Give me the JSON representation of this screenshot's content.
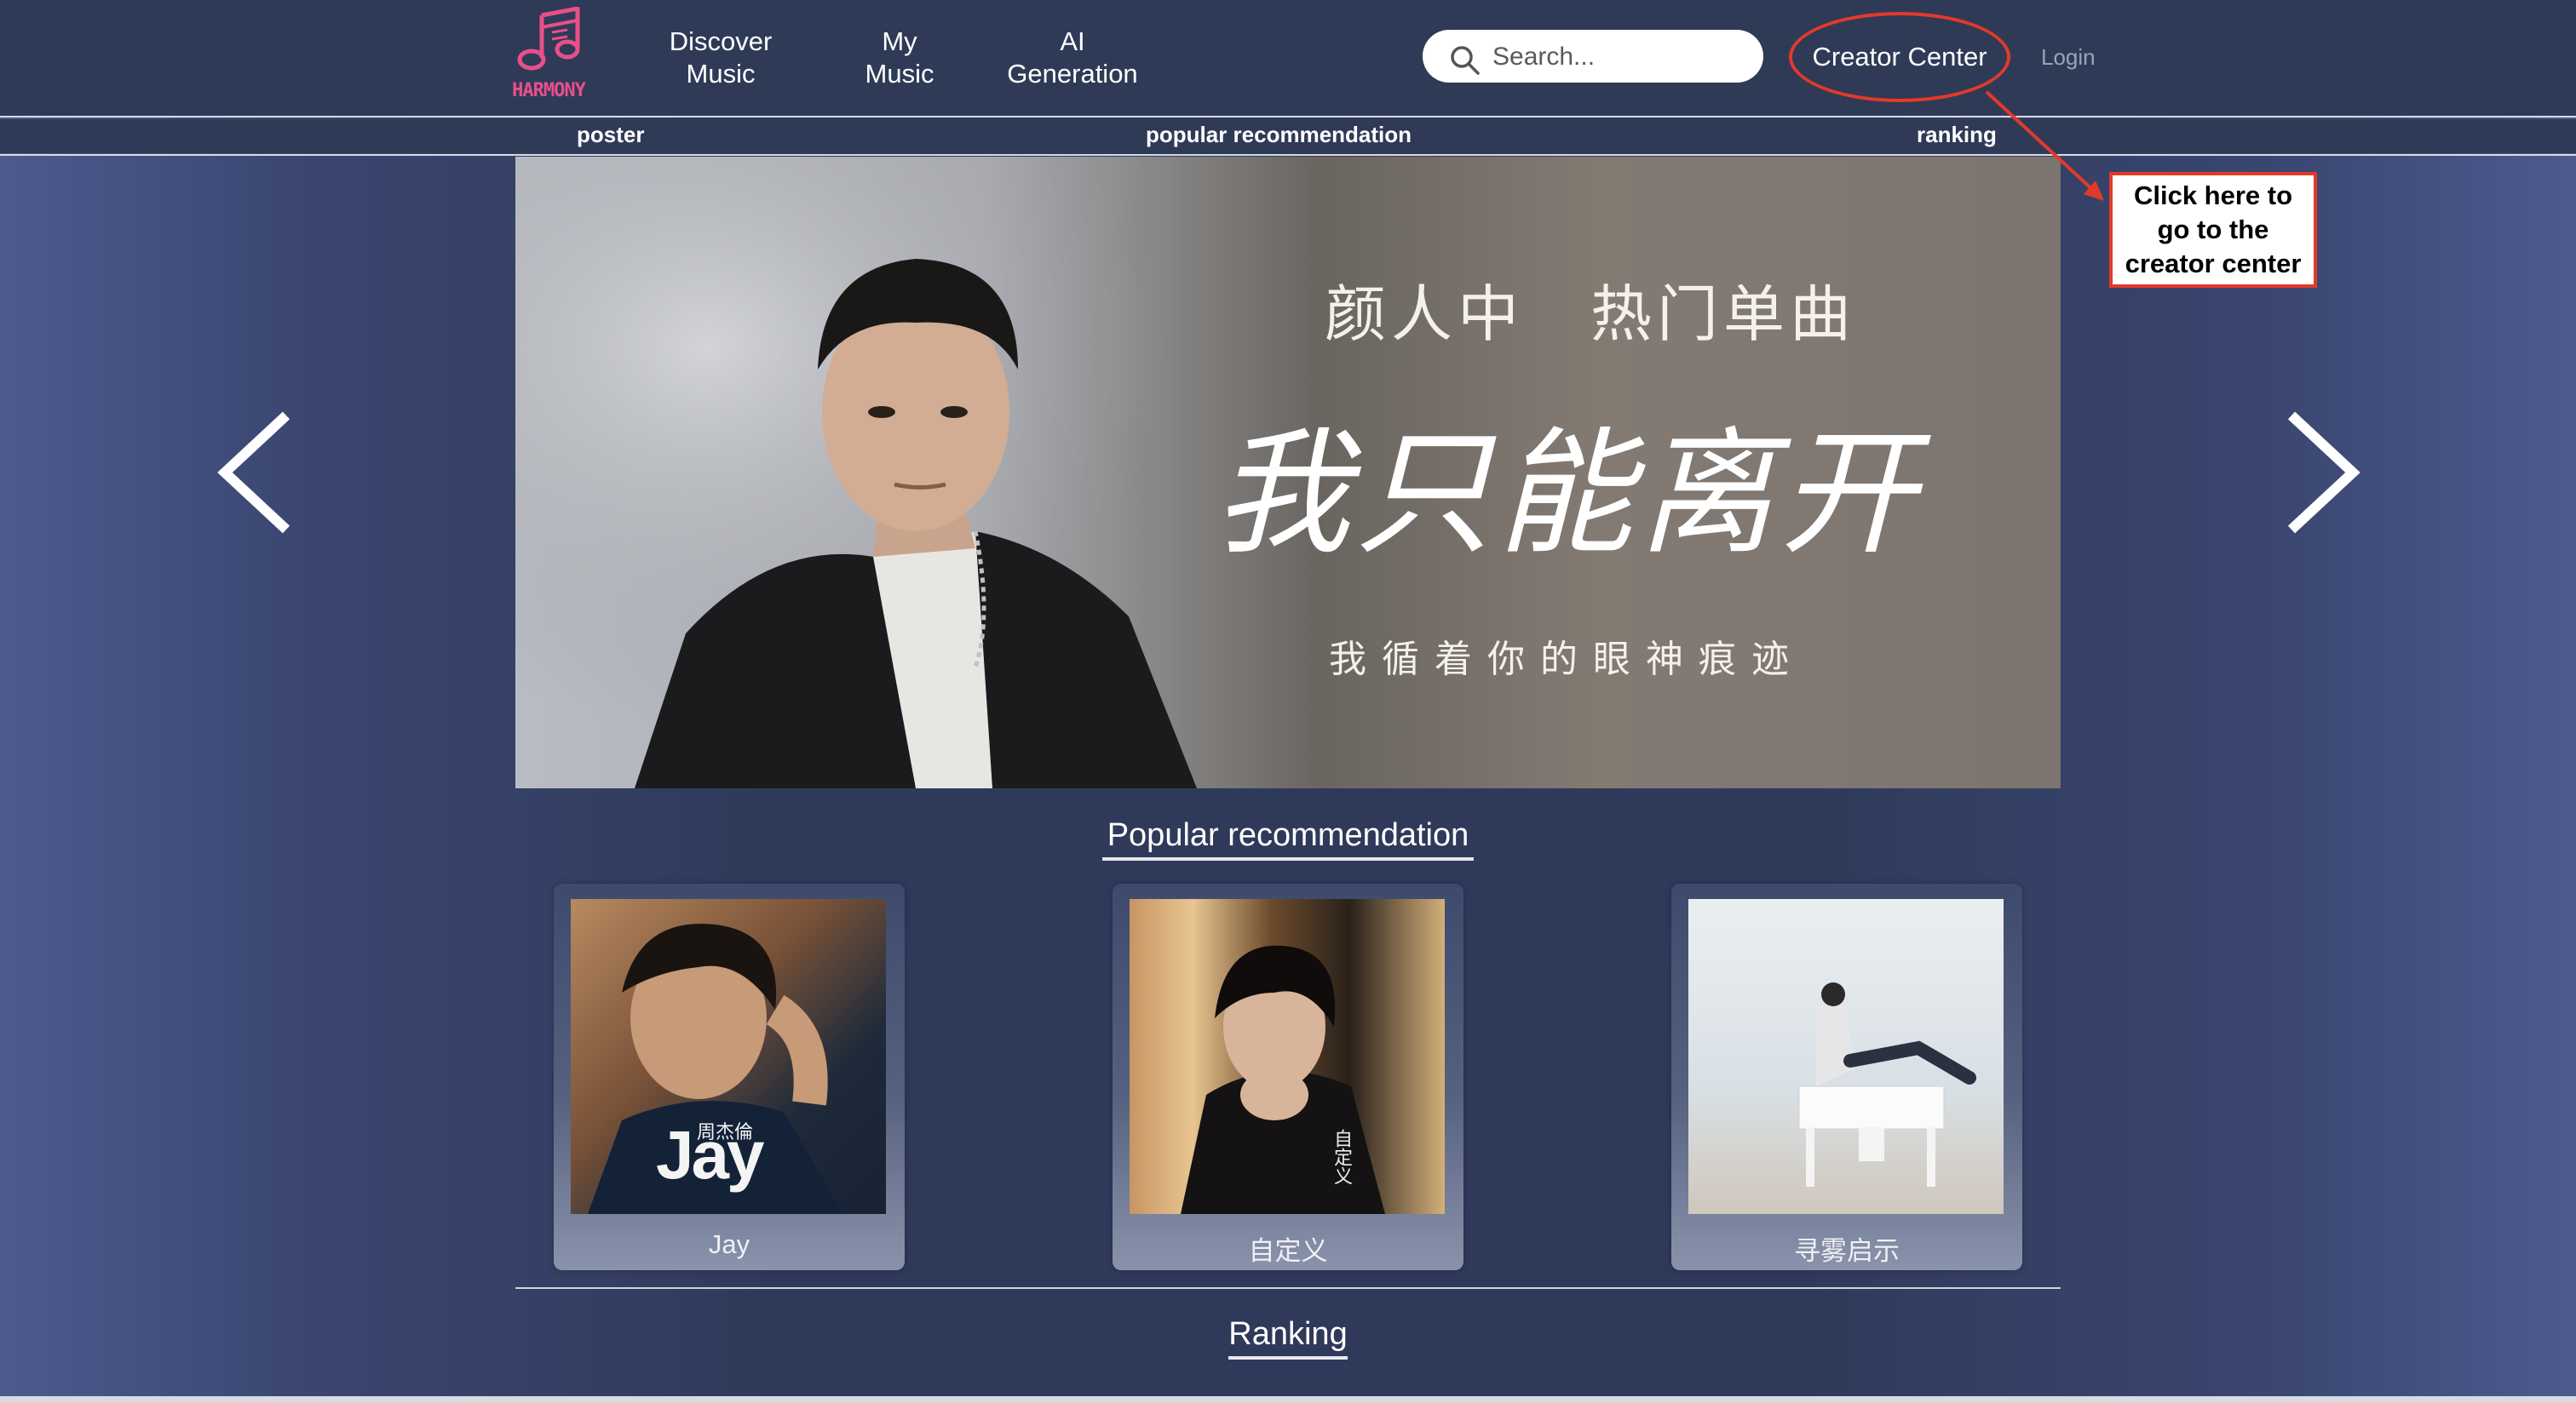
{
  "header": {
    "logo_text": "HARMONY",
    "nav": [
      {
        "line1": "Discover",
        "line2": "Music"
      },
      {
        "line1": "My",
        "line2": "Music"
      },
      {
        "line1": "AI",
        "line2": "Generation"
      }
    ],
    "search_placeholder": "Search...",
    "creator_center": "Creator Center",
    "login": "Login"
  },
  "subnav": {
    "poster": "poster",
    "popular": "popular recommendation",
    "ranking": "ranking"
  },
  "banner": {
    "title": "颜人中　热门单曲",
    "song": "我只能离开",
    "lyric": "我循着你的眼神痕迹"
  },
  "annotation": {
    "text_line1": "Click here to",
    "text_line2": "go to the",
    "text_line3": "creator center",
    "color": "#e23a2a"
  },
  "popular": {
    "title": "Popular recommendation",
    "items": [
      {
        "label": "Jay",
        "cover_text": "Jay",
        "cover_subtext": "周杰倫"
      },
      {
        "label": "自定义",
        "cover_text": "自定义"
      },
      {
        "label": "寻雾启示"
      }
    ]
  },
  "ranking": {
    "title": "Ranking"
  },
  "colors": {
    "background": "#2f3a5a",
    "accent_pink": "#e8508a",
    "annotation_red": "#e23a2a"
  }
}
